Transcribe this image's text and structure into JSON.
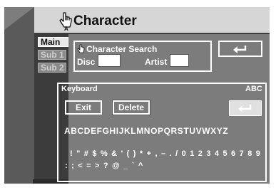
{
  "header": {
    "title": "Character",
    "icon": "hand-cursor-icon"
  },
  "tabs": [
    {
      "label": "Main"
    },
    {
      "label": "Sub 1"
    },
    {
      "label": "Sub 2"
    }
  ],
  "search": {
    "title": "Character Search",
    "disc_label": "Disc",
    "artist_label": "Artist",
    "disc_value": "",
    "artist_value": ""
  },
  "keyboard": {
    "label": "Keyboard",
    "mode": "ABC",
    "exit_label": "Exit",
    "delete_label": "Delete",
    "letters": "ABCDEFGHIJKLMNOPQRSTUVWXYZ",
    "symbols_row1": "! \" # $ % & ' ( ) * + , – . / 0 1 2 3 4 5 6 7 8 9",
    "symbols_row2": ": ; < = > ? @ _ ` ^"
  },
  "colors": {
    "panel": "#7c7c7c",
    "header": "#d6d6d6",
    "text": "#ffffff"
  }
}
